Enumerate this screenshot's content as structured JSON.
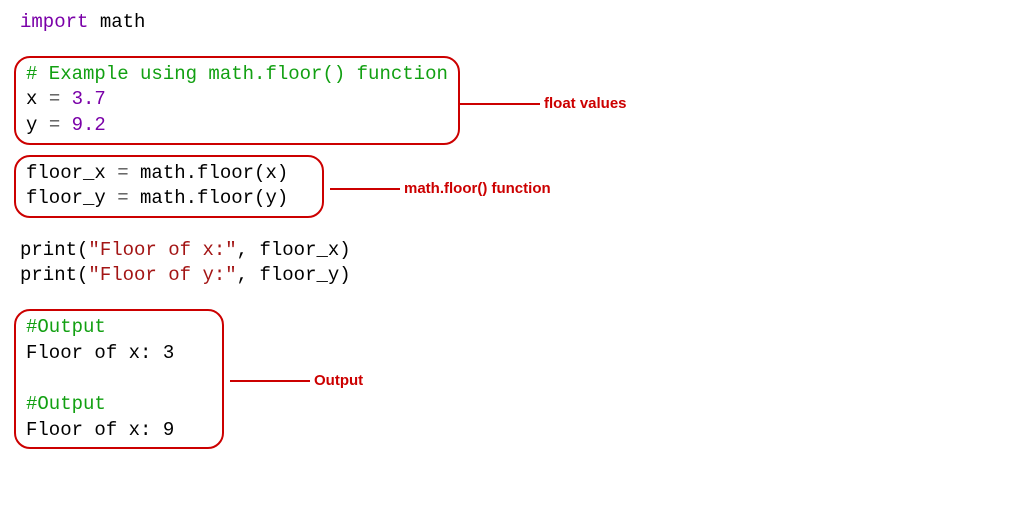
{
  "importLine": {
    "kw": "import",
    "mod": "math"
  },
  "block1": {
    "comment": "# Example using math.floor() function",
    "l2_a": "x ",
    "l2_op": "=",
    "l2_b": " ",
    "l2_num": "3.7",
    "l3_a": "y ",
    "l3_op": "=",
    "l3_b": " ",
    "l3_num": "9.2",
    "annotation": "float values"
  },
  "block2": {
    "l1": "floor_x ",
    "l1_op": "=",
    "l1_b": " math.floor(x)",
    "l2": "floor_y ",
    "l2_op": "=",
    "l2_b": " math.floor(y)",
    "annotation": "math.floor() function"
  },
  "prints": {
    "p1_a": "print(",
    "p1_str": "\"Floor of x:\"",
    "p1_b": ", floor_x)",
    "p2_a": "print(",
    "p2_str": "\"Floor of y:\"",
    "p2_b": ", floor_y)"
  },
  "block3": {
    "c1": "#Output",
    "l1": "Floor of x: 3",
    "c2": "#Output",
    "l2": "Floor of x: 9",
    "annotation": "Output"
  }
}
